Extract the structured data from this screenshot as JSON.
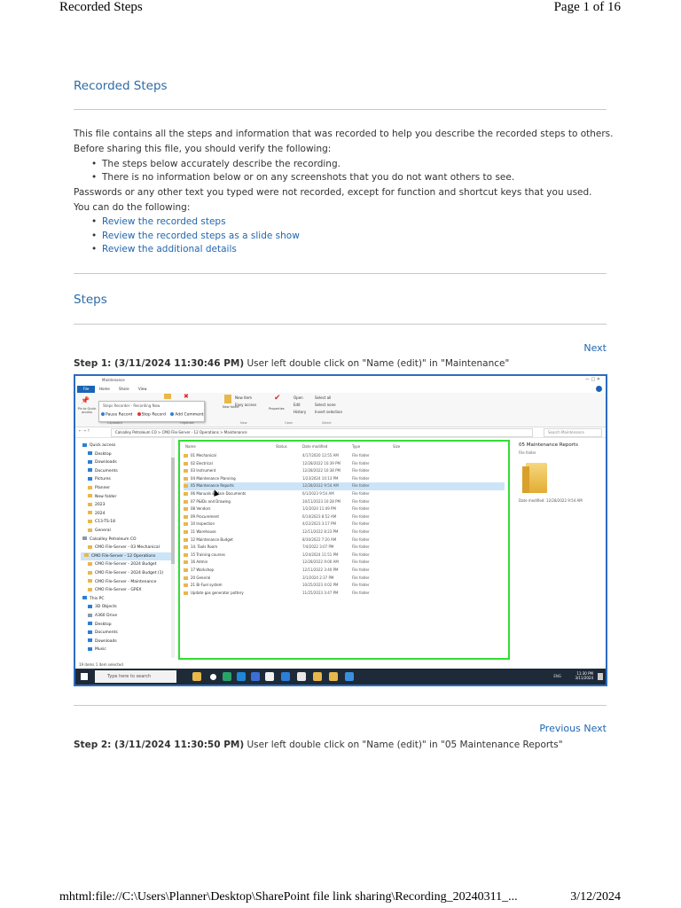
{
  "print_header": {
    "title": "Recorded Steps",
    "page": "Page 1 of 16"
  },
  "print_footer": {
    "url": "mhtml:file://C:\\Users\\Planner\\Desktop\\SharePoint file link sharing\\Recording_20240311_...",
    "date": "3/12/2024"
  },
  "intro": {
    "heading": "Recorded Steps",
    "line1": "This file contains all the steps and information that was recorded to help you describe the recorded steps to others.",
    "line2": "Before sharing this file, you should verify the following:",
    "checks": [
      "The steps below accurately describe the recording.",
      "There is no information below or on any screenshots that you do not want others to see."
    ],
    "line3": "Passwords or any other text you typed were not recorded, except for function and shortcut keys that you used.",
    "line4": "You can do the following:",
    "links": [
      "Review the recorded steps",
      "Review the recorded steps as a slide show",
      "Review the additional details"
    ]
  },
  "steps_heading": "Steps",
  "nav": {
    "next": "Next",
    "previous": "Previous"
  },
  "steps": [
    {
      "label": "Step 1: (3/11/2024 11:30:46 PM)",
      "text": " User left double click on \"Name (edit)\" in \"Maintenance\""
    },
    {
      "label": "Step 2: (3/11/2024 11:30:50 PM)",
      "text": " User left double click on \"Name (edit)\" in \"05 Maintenance Reports\""
    }
  ],
  "screenshot": {
    "window_title": "Maintenance",
    "ribbon_tabs": [
      "File",
      "Home",
      "Share",
      "View"
    ],
    "ribbon_groups": [
      "Clipboard",
      "Organize",
      "New",
      "Open",
      "Select"
    ],
    "ribbon_labels": {
      "new_item": "New item",
      "easy_access": "Easy access",
      "new_folder": "New folder",
      "properties": "Properties",
      "open": "Open",
      "edit": "Edit",
      "history": "History",
      "select_all": "Select all",
      "select_none": "Select none",
      "invert_selection": "Invert selection",
      "pin": "Pin to Quick access"
    },
    "recorder": {
      "title": "Steps Recorder - Recording Now",
      "pause": "Pause Record",
      "stop": "Stop Record",
      "comment": "Add Comment"
    },
    "address": "Calsalley Petroleum CO  >  CMO File-Server - 12 Operations  >  Maintenance",
    "search_placeholder": "Search Maintenance",
    "nav_items": [
      "Quick access",
      "Desktop",
      "Downloads",
      "Documents",
      "Pictures",
      "Planner",
      "New folder",
      "2023",
      "2024",
      "C13-TS-18",
      "General",
      "Calsalley Petroleum CO",
      "CMO File-Server - 03 Mechanical",
      "CMO File-Server - 12 Operations",
      "CMO File-Server - 2024 Budget",
      "CMO File-Server - 2024 Budget (1)",
      "CMO File-Server - Maintenance",
      "CMO File-Server - GPEX",
      "This PC",
      "3D Objects",
      "A360 Drive",
      "Desktop",
      "Documents",
      "Downloads",
      "Music"
    ],
    "columns": [
      "Name",
      "Status",
      "Date modified",
      "Type",
      "Size"
    ],
    "files": [
      {
        "name": "01 Mechanical",
        "date": "4/17/2020 12:55 AM",
        "type": "File folder"
      },
      {
        "name": "02 Electrical",
        "date": "12/28/2022 10:39 PM",
        "type": "File folder"
      },
      {
        "name": "03 Instrument",
        "date": "12/28/2022 10:38 PM",
        "type": "File folder"
      },
      {
        "name": "04 Maintenance Planning",
        "date": "1/23/2024 10:13 PM",
        "type": "File folder"
      },
      {
        "name": "05 Maintenance Reports",
        "date": "12/28/2022 9:54 AM",
        "type": "File folder",
        "selected": true
      },
      {
        "name": "06 Manuals & Main Documents",
        "date": "6/1/2023 9:54 AM",
        "type": "File folder"
      },
      {
        "name": "07 P&IDs and Drawing",
        "date": "10/11/2023 10:28 PM",
        "type": "File folder"
      },
      {
        "name": "08 Vendors",
        "date": "1/2/2024 11:49 PM",
        "type": "File folder"
      },
      {
        "name": "09 Procurement",
        "date": "6/14/2023 8:52 AM",
        "type": "File folder"
      },
      {
        "name": "10 Inspection",
        "date": "4/22/2023 3:17 PM",
        "type": "File folder"
      },
      {
        "name": "11 Warehouse",
        "date": "12/11/2022 8:23 PM",
        "type": "File folder"
      },
      {
        "name": "12 Maintenance Budget",
        "date": "8/30/2022 7:20 AM",
        "type": "File folder"
      },
      {
        "name": "14. Tools Room",
        "date": "7/4/2022 3:07 PM",
        "type": "File folder"
      },
      {
        "name": "15 Training courses",
        "date": "1/24/2024 11:51 PM",
        "type": "File folder"
      },
      {
        "name": "16 Admin",
        "date": "12/28/2022 9:00 AM",
        "type": "File folder"
      },
      {
        "name": "17 Workshop",
        "date": "12/11/2022 3:40 PM",
        "type": "File folder"
      },
      {
        "name": "20 General",
        "date": "3/1/2024 2:37 PM",
        "type": "File folder"
      },
      {
        "name": "21 Bi-Fuel system",
        "date": "10/25/2023 4:02 PM",
        "type": "File folder"
      },
      {
        "name": "Update gas generator pottery",
        "date": "11/25/2023 3:47 PM",
        "type": "File folder"
      }
    ],
    "preview": {
      "name": "05 Maintenance Reports",
      "type": "File folder",
      "date_modified": "Date modified:  12/28/2022 9:54 AM"
    },
    "status": "19 items    1 item selected",
    "taskbar": {
      "search": "Type here to search",
      "tray": "ENG",
      "time": "11:30 PM",
      "date": "3/11/2024"
    },
    "colors": {
      "highlight_border": "#33dd33",
      "frame_border": "#2b6cc0",
      "taskbar": "#1e2a38"
    }
  }
}
